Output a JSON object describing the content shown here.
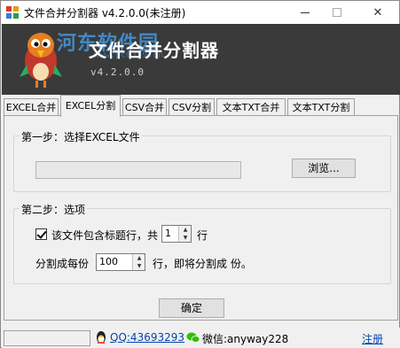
{
  "window": {
    "title": "文件合并分割器 v4.2.0.0(未注册)"
  },
  "banner": {
    "title": "文件合并分割器",
    "version": "v4.2.0.0",
    "watermark": "河东软件园",
    "watermark_url": "www.pc0359.cn"
  },
  "tabs": [
    {
      "label": "EXCEL合并",
      "active": false
    },
    {
      "label": "EXCEL分割",
      "active": true
    },
    {
      "label": "CSV合并",
      "active": false
    },
    {
      "label": "CSV分割",
      "active": false
    },
    {
      "label": "文本TXT合并",
      "active": false
    },
    {
      "label": "文本TXT分割",
      "active": false
    }
  ],
  "step1": {
    "legend": "第一步：选择EXCEL文件",
    "path_value": "",
    "browse_label": "浏览..."
  },
  "step2": {
    "legend": "第二步：选项",
    "header_checkbox_label": "该文件包含标题行，共",
    "header_checked": true,
    "header_rows": "1",
    "header_rows_unit": "行",
    "split_prefix": "分割成每份",
    "split_rows": "100",
    "split_suffix": "行，即将分割成 份。"
  },
  "confirm_label": "确定",
  "statusbar": {
    "qq": "QQ:43693293",
    "wechat": "微信:anyway228",
    "register": "注册"
  },
  "colors": {
    "banner_bg": "#3a3a3a",
    "link": "#0645ad"
  },
  "icons": {
    "app": "app-icon",
    "mascot": "parrot-mascot",
    "qq": "qq-penguin-icon",
    "wechat": "wechat-icon"
  }
}
